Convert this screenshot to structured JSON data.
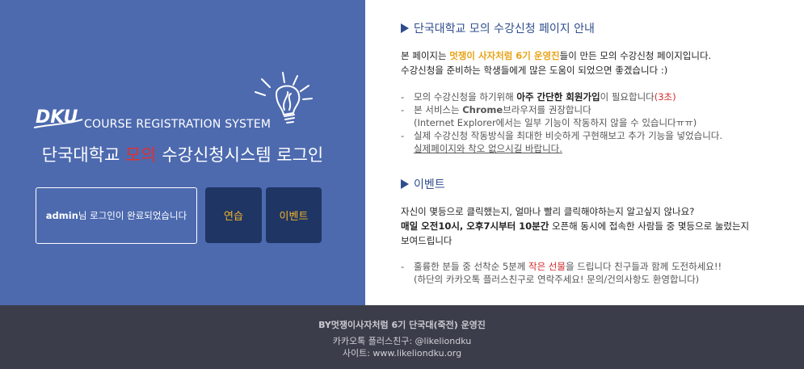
{
  "left": {
    "system_title": "COURSE REGISTRATION SYSTEM",
    "login_title_part1": "단국대학교 ",
    "login_title_highlight": "모의",
    "login_title_part2": " 수강신청시스템 로그인",
    "status_user": "admin",
    "status_text": "님 로그인이 완료되었습니다",
    "practice_button": "연습",
    "event_button": "이벤트",
    "logo_text": "DKU"
  },
  "guide": {
    "title": "단국대학교 모의 수강신청 페이지 안내",
    "p1_a": "본 페이지는 ",
    "p1_highlight": "멋쟁이 사자처럼 6기 운영진",
    "p1_b": "들이 만든 모의 수강신청 페이지입니다.",
    "p2": "수강신청을 준비하는 학생들에게 많은 도움이 되었으면 좋겠습니다 :)",
    "item1_a": "모의 수강신청을 하기위해 ",
    "item1_bold": "아주 간단한 회원가입",
    "item1_b": "이 필요합니다",
    "item1_red": "(3초)",
    "item2_a": "본 서비스는 ",
    "item2_bold": "Chrome",
    "item2_b": "브라우저를 권장합니다",
    "item2_c": "(Internet Explorer에서는 일부 기능이 작동하지 않을 수 있습니다ㅠㅠ)",
    "item3_a": "실제 수강신청 작동방식을 최대한 비슷하게 구현해보고 추가 기능을 넣었습니다.",
    "item3_b": "실제페이지와 착오 없으시길 바랍니다."
  },
  "event": {
    "title": "이벤트",
    "p1": "자신이 몇등으로 클릭했는지, 얼마나 빨리 클릭해야하는지 알고싶지 않나요?",
    "p2_bold": "매일 오전10시, 오후7시부터 10분간",
    "p2_b": " 오픈해 동시에 접속한 사람들 중 몇등으로 눌렀는지",
    "p3": "보여드립니다",
    "item1_a": "훌륭한 분들 중 선착순 5분께 ",
    "item1_red": "작은 선물",
    "item1_b": "을 드립니다 친구들과 함께 도전하세요!!",
    "item1_c": "(하단의 카카오톡 플러스친구로 연락주세요! 문의/건의사항도 환영합니다)"
  },
  "footer": {
    "line1": "BY멋쟁이사자처럼 6기 단국대(죽전) 운영진",
    "line2": "카카오톡 플러스친구: @likeliondku",
    "line3": "사이트: www.likeliondku.org"
  },
  "colors": {
    "left_bg": "#4d6aaf",
    "button_bg": "#1f3563",
    "button_text": "#f0b429",
    "footer_bg": "#3b3d4a",
    "accent_blue": "#2e4d8c",
    "highlight_orange": "#e8a317",
    "highlight_red": "#d42a2a"
  }
}
